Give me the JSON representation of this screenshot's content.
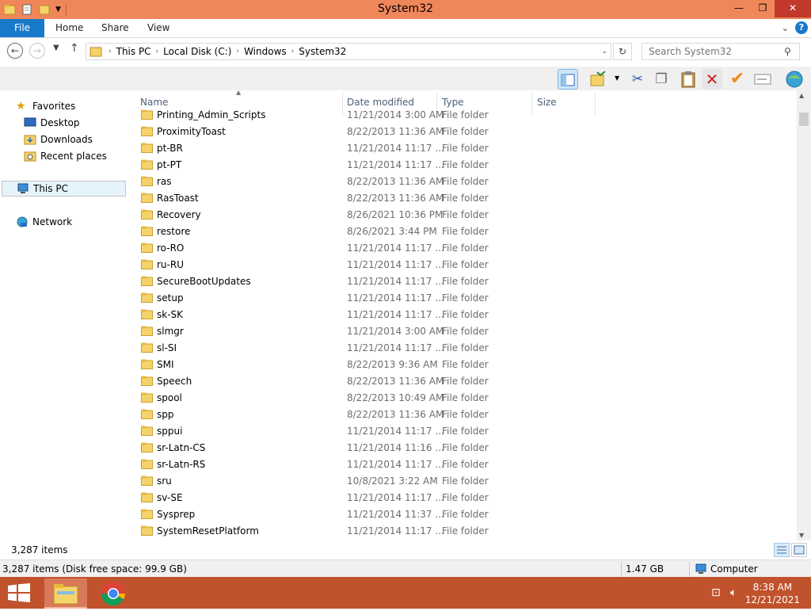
{
  "window": {
    "title": "System32"
  },
  "ribbon": {
    "tabs": [
      "File",
      "Home",
      "Share",
      "View"
    ]
  },
  "address": {
    "crumbs": [
      "This PC",
      "Local Disk (C:)",
      "Windows",
      "System32"
    ],
    "search_placeholder": "Search System32"
  },
  "nav": {
    "favorites": "Favorites",
    "desktop": "Desktop",
    "downloads": "Downloads",
    "recent": "Recent places",
    "thispc": "This PC",
    "network": "Network"
  },
  "columns": {
    "name": "Name",
    "date": "Date modified",
    "type": "Type",
    "size": "Size"
  },
  "rows": [
    {
      "name": "Printing_Admin_Scripts",
      "date": "11/21/2014 3:00 AM",
      "type": "File folder"
    },
    {
      "name": "ProximityToast",
      "date": "8/22/2013 11:36 AM",
      "type": "File folder"
    },
    {
      "name": "pt-BR",
      "date": "11/21/2014 11:17 ...",
      "type": "File folder"
    },
    {
      "name": "pt-PT",
      "date": "11/21/2014 11:17 ...",
      "type": "File folder"
    },
    {
      "name": "ras",
      "date": "8/22/2013 11:36 AM",
      "type": "File folder"
    },
    {
      "name": "RasToast",
      "date": "8/22/2013 11:36 AM",
      "type": "File folder"
    },
    {
      "name": "Recovery",
      "date": "8/26/2021 10:36 PM",
      "type": "File folder"
    },
    {
      "name": "restore",
      "date": "8/26/2021 3:44 PM",
      "type": "File folder"
    },
    {
      "name": "ro-RO",
      "date": "11/21/2014 11:17 ...",
      "type": "File folder"
    },
    {
      "name": "ru-RU",
      "date": "11/21/2014 11:17 ...",
      "type": "File folder"
    },
    {
      "name": "SecureBootUpdates",
      "date": "11/21/2014 11:17 ...",
      "type": "File folder"
    },
    {
      "name": "setup",
      "date": "11/21/2014 11:17 ...",
      "type": "File folder"
    },
    {
      "name": "sk-SK",
      "date": "11/21/2014 11:17 ...",
      "type": "File folder"
    },
    {
      "name": "slmgr",
      "date": "11/21/2014 3:00 AM",
      "type": "File folder"
    },
    {
      "name": "sl-SI",
      "date": "11/21/2014 11:17 ...",
      "type": "File folder"
    },
    {
      "name": "SMI",
      "date": "8/22/2013 9:36 AM",
      "type": "File folder"
    },
    {
      "name": "Speech",
      "date": "8/22/2013 11:36 AM",
      "type": "File folder"
    },
    {
      "name": "spool",
      "date": "8/22/2013 10:49 AM",
      "type": "File folder"
    },
    {
      "name": "spp",
      "date": "8/22/2013 11:36 AM",
      "type": "File folder"
    },
    {
      "name": "sppui",
      "date": "11/21/2014 11:17 ...",
      "type": "File folder"
    },
    {
      "name": "sr-Latn-CS",
      "date": "11/21/2014 11:16 ...",
      "type": "File folder"
    },
    {
      "name": "sr-Latn-RS",
      "date": "11/21/2014 11:17 ...",
      "type": "File folder"
    },
    {
      "name": "sru",
      "date": "10/8/2021 3:22 AM",
      "type": "File folder"
    },
    {
      "name": "sv-SE",
      "date": "11/21/2014 11:17 ...",
      "type": "File folder"
    },
    {
      "name": "Sysprep",
      "date": "11/21/2014 11:37 ...",
      "type": "File folder"
    },
    {
      "name": "SystemResetPlatform",
      "date": "11/21/2014 11:17 ...",
      "type": "File folder"
    }
  ],
  "status": {
    "item_count": "3,287 items"
  },
  "details": {
    "summary": "3,287 items (Disk free space: 99.9 GB)",
    "size": "1.47 GB",
    "location": "Computer"
  },
  "taskbar": {
    "time": "8:38 AM",
    "date": "12/21/2021"
  },
  "colors": {
    "titlebar": "#f0875a",
    "taskbar": "#c0522c",
    "file_tab": "#1979ca"
  }
}
